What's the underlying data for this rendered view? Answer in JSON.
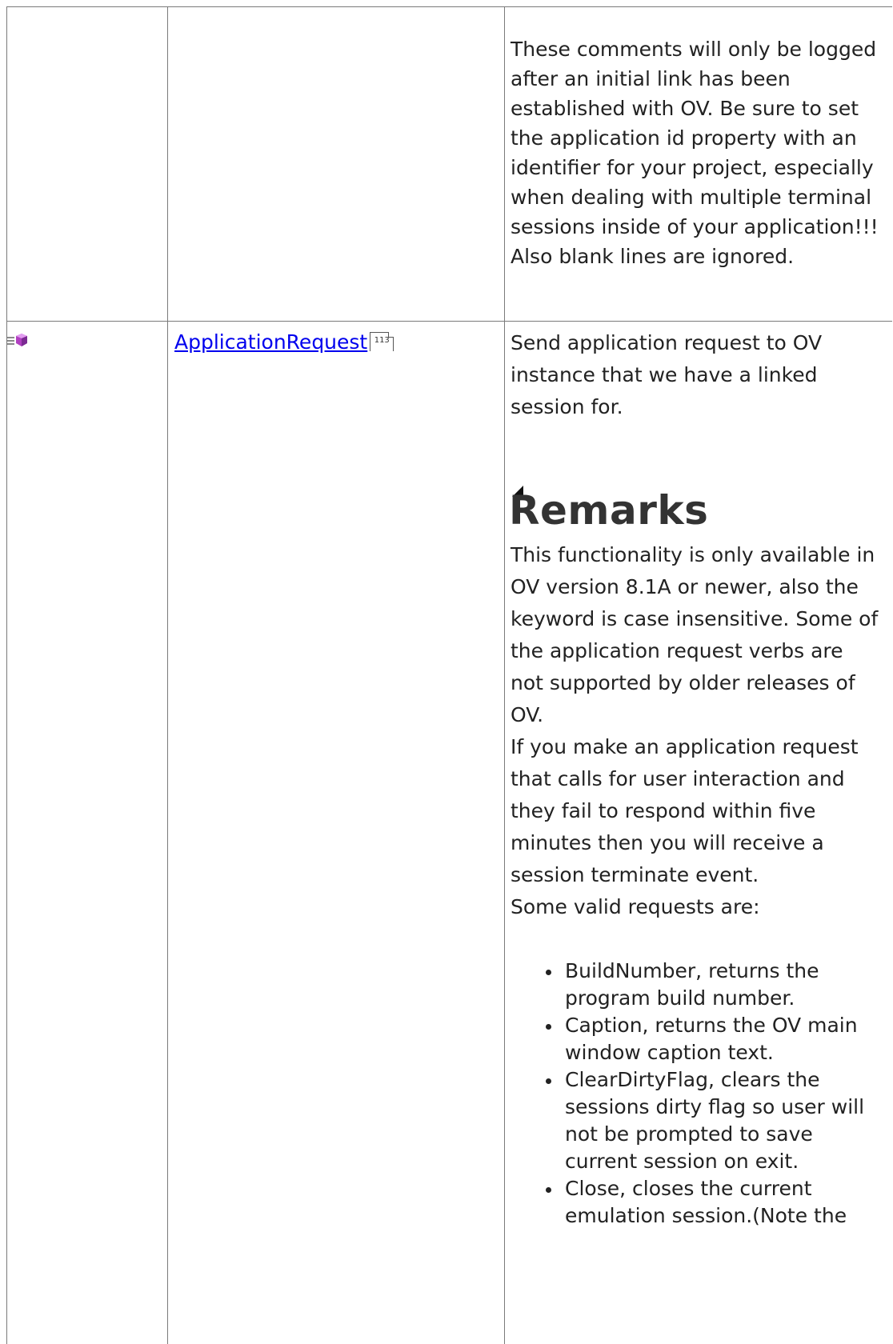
{
  "top_row": {
    "description": "These comments will only be logged after an initial link has been established with OV. Be sure to set the application id property with an identifier for your project, especially when dealing with multiple terminal sessions inside of your application!!! Also blank lines are ignored."
  },
  "member_row": {
    "icon": "method-icon",
    "name": "ApplicationRequest",
    "page_ref": "113",
    "summary": "Send application request to OV instance that we have a linked session for.",
    "remarks_heading": "Remarks",
    "remarks_paragraphs": [
      "This functionality is only available in OV version 8.1A or newer, also the keyword is case insensitive. Some of the application request verbs are not supported by older releases of OV.",
      "If you make an application request that calls for user interaction and they fail to respond within five minutes then you will receive a session terminate event.",
      "Some valid requests are:"
    ],
    "requests": [
      "BuildNumber, returns the program build number.",
      "Caption, returns the OV main window caption text.",
      "ClearDirtyFlag, clears the sessions dirty flag so user will not be prompted to save current session on exit.",
      "Close, closes the current emulation session.(Note the"
    ]
  },
  "colors": {
    "border": "#7a7a7a",
    "link": "#0000ee",
    "text": "#222222"
  }
}
